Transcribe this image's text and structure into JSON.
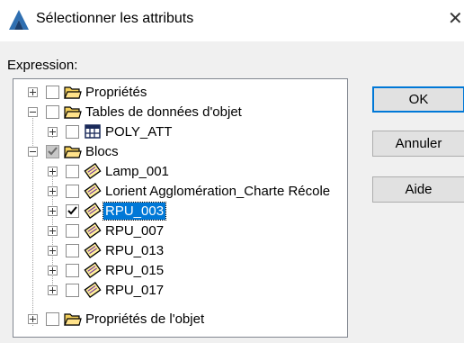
{
  "window": {
    "title": "Sélectionner les attributs",
    "close_glyph": "✕"
  },
  "expression_label": "Expression:",
  "tree": [
    {
      "label": "Propriétés",
      "icon": "folder-icon",
      "check": "unchecked",
      "expander": "plus"
    },
    {
      "label": "Tables de données d'objet",
      "icon": "folder-icon",
      "check": "unchecked",
      "expander": "minus"
    },
    {
      "label": "POLY_ATT",
      "icon": "table-icon",
      "check": "unchecked",
      "expander": "plus"
    },
    {
      "label": "Blocs",
      "icon": "folder-icon",
      "check": "grayed",
      "expander": "minus"
    },
    {
      "label": "Lamp_001",
      "icon": "block-icon",
      "check": "unchecked",
      "expander": "plus"
    },
    {
      "label": "Lorient Agglomération_Charte Récole",
      "icon": "block-icon",
      "check": "unchecked",
      "expander": "plus"
    },
    {
      "label": "RPU_003",
      "icon": "block-icon",
      "check": "checked",
      "expander": "plus",
      "selected": true
    },
    {
      "label": "RPU_007",
      "icon": "block-icon",
      "check": "unchecked",
      "expander": "plus"
    },
    {
      "label": "RPU_013",
      "icon": "block-icon",
      "check": "unchecked",
      "expander": "plus"
    },
    {
      "label": "RPU_015",
      "icon": "block-icon",
      "check": "unchecked",
      "expander": "plus"
    },
    {
      "label": "RPU_017",
      "icon": "block-icon",
      "check": "unchecked",
      "expander": "plus"
    },
    {
      "label": "Propriétés de l'objet",
      "icon": "folder-icon",
      "check": "unchecked",
      "expander": "plus"
    }
  ],
  "buttons": {
    "ok": "OK",
    "cancel": "Annuler",
    "help": "Aide"
  },
  "colors": {
    "selection": "#0078d7",
    "accent": "#0078d7"
  }
}
